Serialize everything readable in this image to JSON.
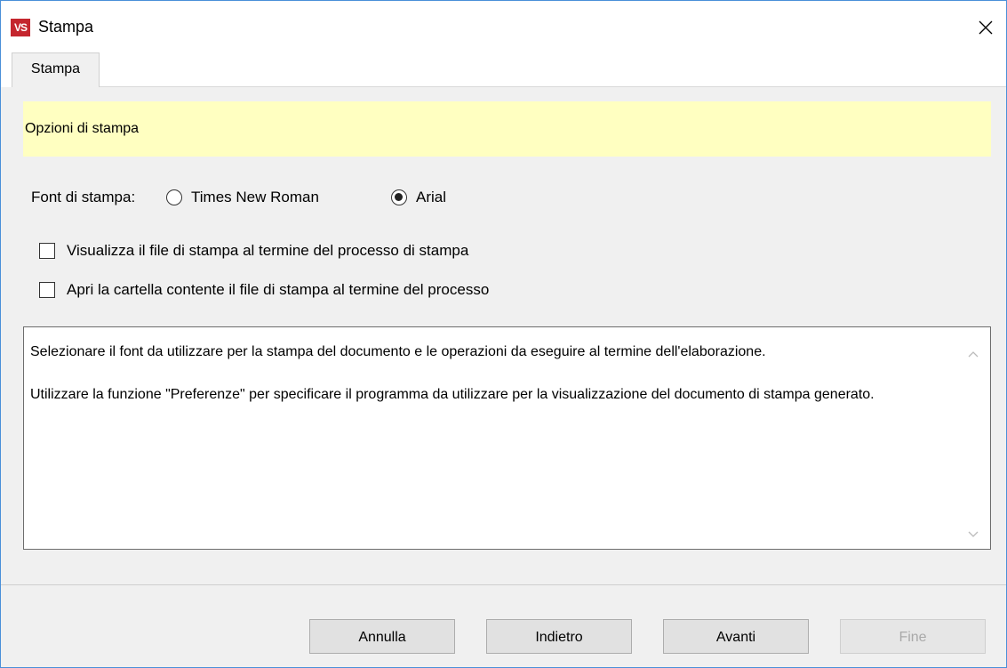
{
  "window": {
    "title": "Stampa",
    "app_icon_text": "VS",
    "close_glyph": "×"
  },
  "tabs": [
    {
      "label": "Stampa",
      "active": true
    }
  ],
  "header": {
    "text": "Opzioni di stampa",
    "background": "#ffffc1"
  },
  "font_options": {
    "label": "Font di stampa:",
    "options": [
      {
        "label": "Times New Roman",
        "selected": false
      },
      {
        "label": "Arial",
        "selected": true
      }
    ]
  },
  "checkboxes": [
    {
      "label": "Visualizza il file di stampa al termine del processo di stampa",
      "checked": false
    },
    {
      "label": "Apri la cartella contente il file di stampa al termine del processo",
      "checked": false
    }
  ],
  "description": {
    "paragraph1": "Selezionare il font da utilizzare per la stampa del documento e le operazioni da eseguire al termine dell'elaborazione.",
    "paragraph2": "Utilizzare la funzione \"Preferenze\" per specificare il programma da utilizzare per la visualizzazione del documento di stampa generato."
  },
  "buttons": {
    "cancel": "Annulla",
    "back": "Indietro",
    "next": "Avanti",
    "finish": "Fine",
    "finish_disabled": true
  }
}
